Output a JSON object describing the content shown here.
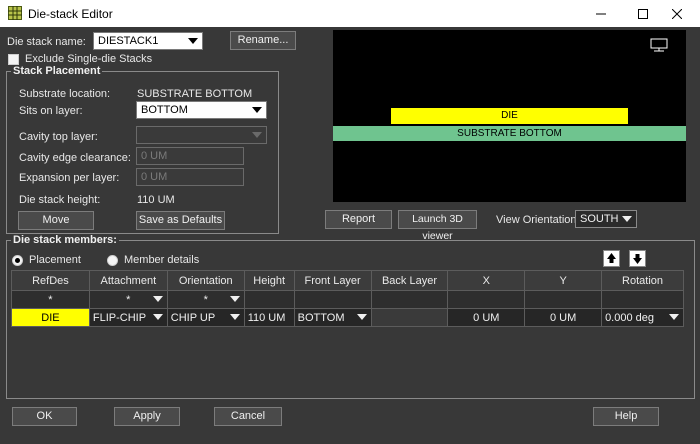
{
  "window": {
    "title": "Die-stack Editor"
  },
  "header": {
    "die_stack_name_label": "Die stack name:",
    "die_stack_name_value": "DIESTACK1",
    "rename_label": "Rename...",
    "exclude_label": "Exclude Single-die Stacks"
  },
  "placement": {
    "group_title": "Stack Placement",
    "substrate_location_label": "Substrate location:",
    "substrate_location_value": "SUBSTRATE BOTTOM",
    "sits_on_layer_label": "Sits on layer:",
    "sits_on_layer_value": "BOTTOM",
    "cavity_top_layer_label": "Cavity top layer:",
    "cavity_edge_clearance_label": "Cavity edge clearance:",
    "cavity_edge_clearance_value": "0 UM",
    "expansion_per_layer_label": "Expansion per layer:",
    "expansion_per_layer_value": "0 UM",
    "die_stack_height_label": "Die stack height:",
    "die_stack_height_value": "110 UM",
    "move_label": "Move",
    "save_defaults_label": "Save as Defaults"
  },
  "preview": {
    "die_label": "DIE",
    "substrate_label": "SUBSTRATE BOTTOM",
    "die_color": "#ffff00",
    "substrate_color": "#6fc48f"
  },
  "actions": {
    "report_label": "Report",
    "launch3d_label": "Launch 3D viewer",
    "view_orientation_label": "View Orientation:",
    "view_orientation_value": "SOUTH"
  },
  "members": {
    "group_title": "Die stack members:",
    "radio_placement": "Placement",
    "radio_member_details": "Member details",
    "columns": [
      "RefDes",
      "Attachment",
      "Orientation",
      "Height",
      "Front Layer",
      "Back Layer",
      "X",
      "Y",
      "Rotation"
    ],
    "filter": {
      "refdes": "*",
      "attachment": "*",
      "orientation": "*"
    },
    "row": {
      "refdes": "DIE",
      "attachment": "FLIP-CHIP",
      "orientation": "CHIP UP",
      "height": "110 UM",
      "front_layer": "BOTTOM",
      "back_layer": "",
      "x": "0 UM",
      "y": "0 UM",
      "rotation": "0.000 deg"
    }
  },
  "footer": {
    "ok_label": "OK",
    "apply_label": "Apply",
    "cancel_label": "Cancel",
    "help_label": "Help"
  }
}
